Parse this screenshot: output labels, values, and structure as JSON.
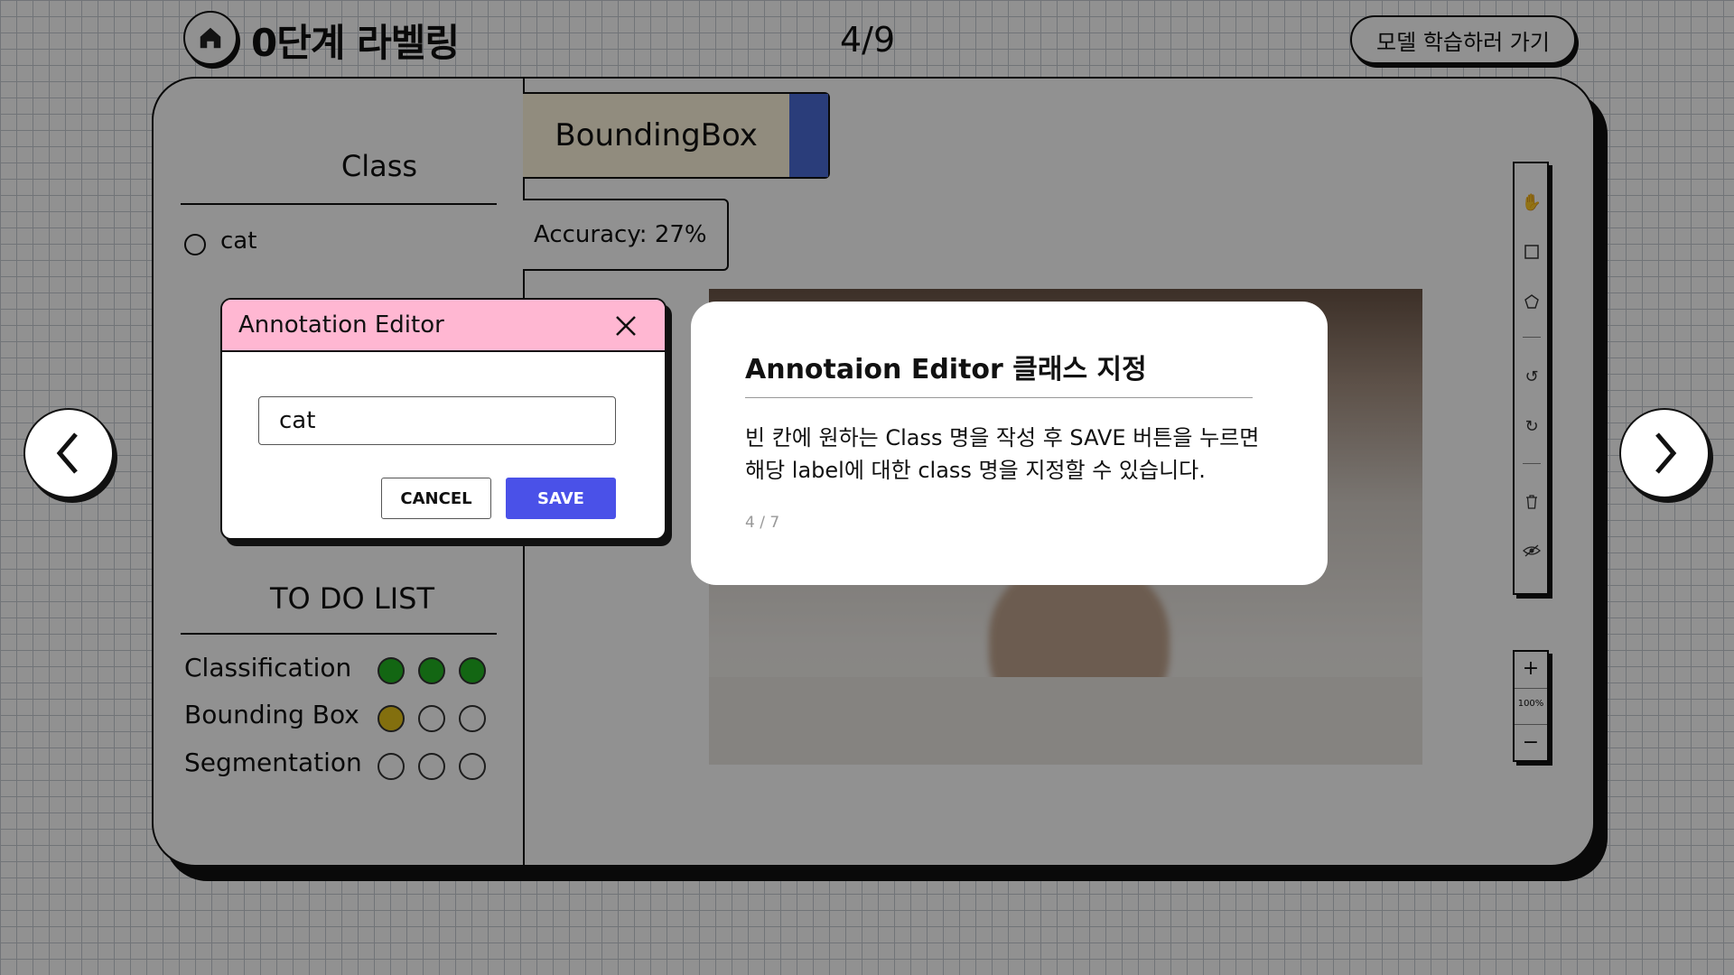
{
  "header": {
    "title": "0단계 라벨링",
    "page_counter": "4/9",
    "model_button": "모델 학습하러 가기"
  },
  "sidebar": {
    "class_title": "Class",
    "classes": [
      {
        "label": "cat"
      }
    ],
    "todo_title": "TO DO LIST",
    "todo": [
      {
        "label": "Classification",
        "status": [
          "done",
          "done",
          "done"
        ]
      },
      {
        "label": "Bounding Box",
        "status": [
          "current",
          "empty",
          "empty"
        ]
      },
      {
        "label": "Segmentation",
        "status": [
          "empty",
          "empty",
          "empty"
        ]
      }
    ]
  },
  "workspace": {
    "mode_tab": "BoundingBox",
    "accuracy": "Accuracy: 27%",
    "zoom_level": "100%"
  },
  "colors": {
    "done": "#22b422",
    "current": "#e6c419",
    "empty": "#ffffff",
    "dialog_header": "#ffb7d2",
    "save_button": "#4a51e8",
    "mode_accent": "#4a6bd6"
  },
  "icons": {
    "home": "home-icon",
    "prev": "chevron-left-icon",
    "next": "chevron-right-icon",
    "close": "close-icon",
    "tools": [
      "hand-icon",
      "rectangle-icon",
      "polygon-icon",
      "undo-icon",
      "redo-icon",
      "trash-icon",
      "eye-off-icon"
    ],
    "zoom_in": "plus-icon",
    "zoom_out": "minus-icon"
  },
  "dialog": {
    "title": "Annotation Editor",
    "input_value": "cat",
    "cancel_label": "CANCEL",
    "save_label": "SAVE"
  },
  "tutorial": {
    "title": "Annotaion Editor 클래스 지정",
    "body_line1": "빈 칸에 원하는 Class 명을 작성 후 SAVE 버튼을 누르면",
    "body_line2": "해당 label에 대한 class 명을 지정할 수 있습니다.",
    "step": "4 / 7"
  }
}
